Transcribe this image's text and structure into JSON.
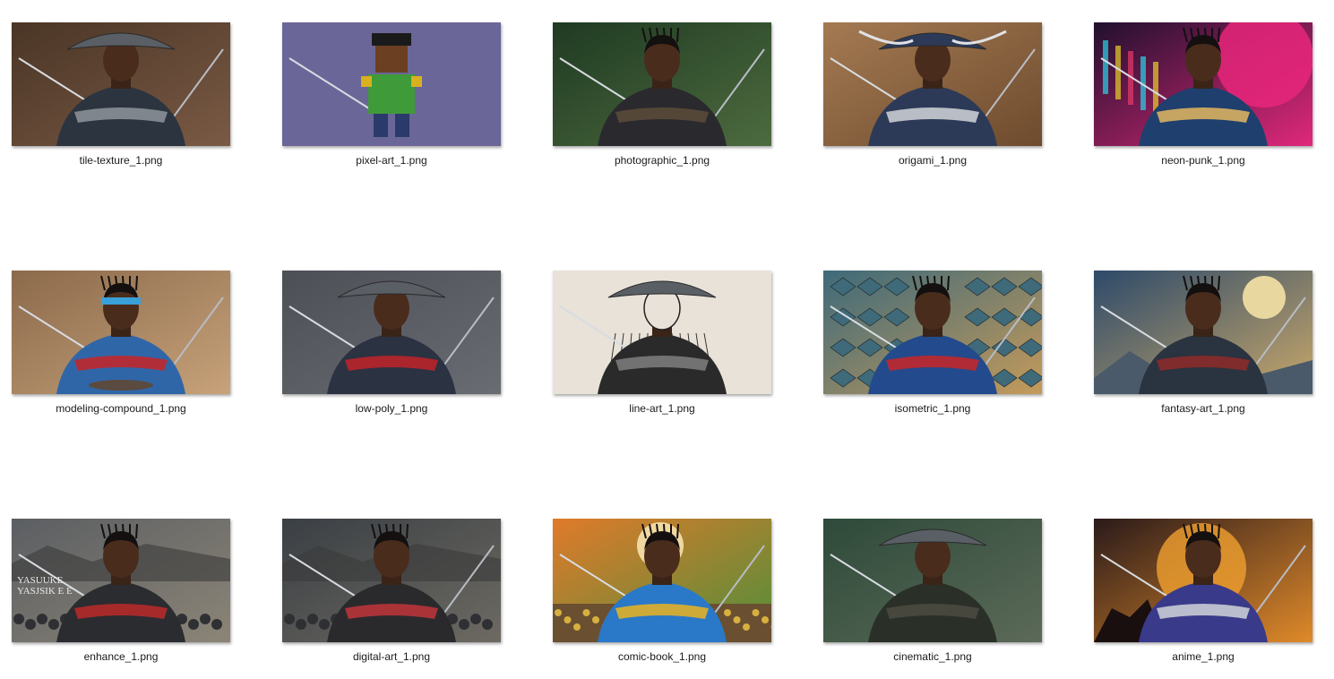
{
  "files": [
    {
      "name": "tile-texture_1.png",
      "bg": [
        "#4a3526",
        "#7a5a44"
      ],
      "figure": "#2c3440",
      "accent": "#8a8f96",
      "hat": true,
      "style": "photo"
    },
    {
      "name": "pixel-art_1.png",
      "bg": [
        "#6b6698",
        "#6b6698"
      ],
      "figure": "#3f9a3a",
      "accent": "#d8b020",
      "hat": false,
      "style": "pixel"
    },
    {
      "name": "photographic_1.png",
      "bg": [
        "#1f3a22",
        "#4d6b3f"
      ],
      "figure": "#2a2a2e",
      "accent": "#5a4a3a",
      "hat": false,
      "style": "photo"
    },
    {
      "name": "origami_1.png",
      "bg": [
        "#a47a52",
        "#6e4b2e"
      ],
      "figure": "#2c3a58",
      "accent": "#c9ccd2",
      "hat": true,
      "style": "origami"
    },
    {
      "name": "neon-punk_1.png",
      "bg": [
        "#20102e",
        "#e0287a"
      ],
      "figure": "#1f3f6e",
      "accent": "#d8b060",
      "hat": false,
      "style": "neon"
    },
    {
      "name": "modeling-compound_1.png",
      "bg": [
        "#8b6a4b",
        "#c7a27a"
      ],
      "figure": "#2f66a8",
      "accent": "#c0282c",
      "hat": false,
      "style": "clay"
    },
    {
      "name": "low-poly_1.png",
      "bg": [
        "#4d4f56",
        "#6a6c73"
      ],
      "figure": "#2b3242",
      "accent": "#b8242a",
      "hat": true,
      "style": "poly"
    },
    {
      "name": "line-art_1.png",
      "bg": [
        "#e8e2d8",
        "#e8e2d8"
      ],
      "figure": "#2a2a2a",
      "accent": "#7a7a7a",
      "hat": true,
      "style": "line"
    },
    {
      "name": "isometric_1.png",
      "bg": [
        "#3e6a7a",
        "#c49a5a"
      ],
      "figure": "#234a8c",
      "accent": "#c0282c",
      "hat": false,
      "style": "iso"
    },
    {
      "name": "fantasy-art_1.png",
      "bg": [
        "#2d4a6a",
        "#c9a86a"
      ],
      "figure": "#2a3340",
      "accent": "#8a2a2a",
      "hat": false,
      "style": "fantasy"
    },
    {
      "name": "enhance_1.png",
      "bg": [
        "#5b5e62",
        "#8c8577"
      ],
      "figure": "#2a2c30",
      "accent": "#b52a2a",
      "hat": false,
      "style": "enhance"
    },
    {
      "name": "digital-art_1.png",
      "bg": [
        "#3a3f44",
        "#6d6a62"
      ],
      "figure": "#2a2a2c",
      "accent": "#b8343a",
      "hat": false,
      "style": "photo"
    },
    {
      "name": "comic-book_1.png",
      "bg": [
        "#e07a2a",
        "#4f8f3a"
      ],
      "figure": "#2a78c8",
      "accent": "#e0b028",
      "hat": false,
      "style": "comic"
    },
    {
      "name": "cinematic_1.png",
      "bg": [
        "#2e4a3a",
        "#5c6a58"
      ],
      "figure": "#2a3028",
      "accent": "#4a4a40",
      "hat": true,
      "style": "photo"
    },
    {
      "name": "anime_1.png",
      "bg": [
        "#2a1a1a",
        "#e08a2a"
      ],
      "figure": "#3a3a8a",
      "accent": "#c8ccd4",
      "hat": false,
      "style": "anime"
    }
  ],
  "overlay_text": {
    "enhance_title_1": "YASUUKE",
    "enhance_title_2": "YASJSIK E E"
  }
}
